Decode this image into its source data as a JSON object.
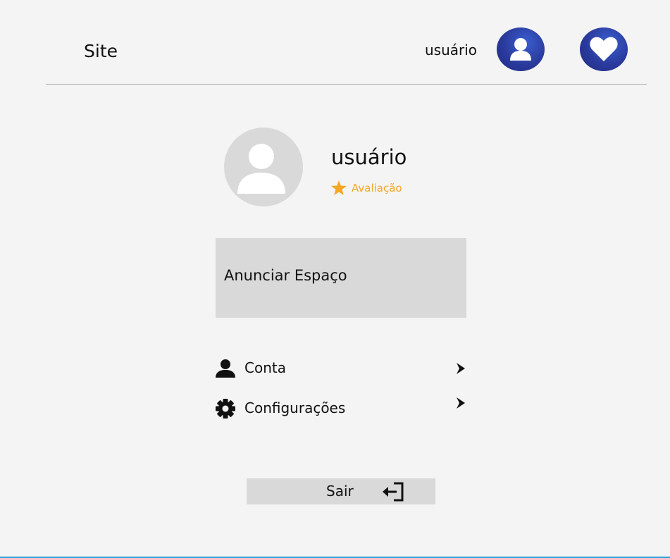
{
  "header": {
    "site_title": "Site",
    "username": "usuário",
    "user_button_icon": "user-icon",
    "favorites_button_icon": "heart-icon",
    "accent_color": "#2a3a9c"
  },
  "profile": {
    "avatar_icon": "user-icon",
    "name": "usuário",
    "rating_icon": "star-icon",
    "rating_label": "Avaliação",
    "rating_color": "#f5a623"
  },
  "announce": {
    "label": "Anunciar Espaço"
  },
  "menu": {
    "items": [
      {
        "icon": "user-icon",
        "label": "Conta",
        "chevron": "chevron-right-icon"
      },
      {
        "icon": "gear-icon",
        "label": "Configurações",
        "chevron": "chevron-right-icon"
      }
    ]
  },
  "logout": {
    "label": "Sair",
    "icon": "logout-icon"
  }
}
